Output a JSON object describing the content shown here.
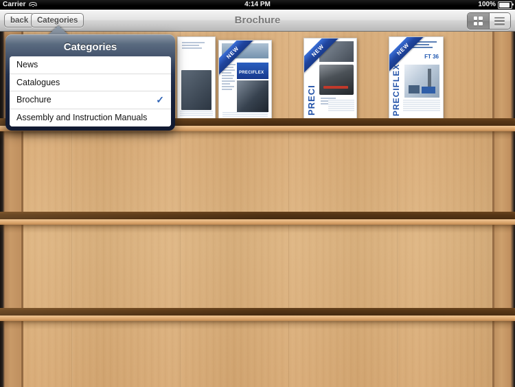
{
  "status_bar": {
    "carrier": "Carrier",
    "wifi_icon": "wifi-icon",
    "time": "4:14 PM",
    "battery_percent": "100%",
    "battery_icon": "battery-full-icon"
  },
  "toolbar": {
    "back_label": "back",
    "categories_label": "Categories",
    "title": "Brochure",
    "view_toggle": {
      "grid_icon": "grid-view-icon",
      "list_icon": "list-view-icon",
      "selected": "grid"
    }
  },
  "popover": {
    "title": "Categories",
    "selected": "Brochure",
    "check_glyph": "✓",
    "items": [
      {
        "label": "News",
        "checked": false
      },
      {
        "label": "Catalogues",
        "checked": false
      },
      {
        "label": "Brochure",
        "checked": true
      },
      {
        "label": "Assembly and Instruction Manuals",
        "checked": false
      }
    ]
  },
  "bookshelf": {
    "shelf_count": 4,
    "books": [
      {
        "name": "book-partial-behind-popover",
        "ribbon": "",
        "headline": "",
        "brand": "",
        "vertical_text": ""
      },
      {
        "name": "book-preciflex-screw",
        "ribbon": "NEW",
        "headline": "IT LOW COSTS AND MORE IMPORTANT ARE YOU THAN BIG PROMISES",
        "brand": "PRECIFLEX",
        "vertical_text": ""
      },
      {
        "name": "book-preci-toolcase",
        "ribbon": "NEW",
        "headline": "",
        "brand": "",
        "vertical_text": "PRECI"
      },
      {
        "name": "book-preciflex-ft36",
        "ribbon": "NEW",
        "headline": "",
        "brand": "FT 36",
        "vertical_text": "PRECIFLEX"
      }
    ]
  },
  "colors": {
    "accent_blue": "#2f63b5",
    "ribbon_blue": "#20459f",
    "wood_light": "#dcb07d",
    "wood_shelf": "#5b3917",
    "popover_dark": "#16203a"
  }
}
